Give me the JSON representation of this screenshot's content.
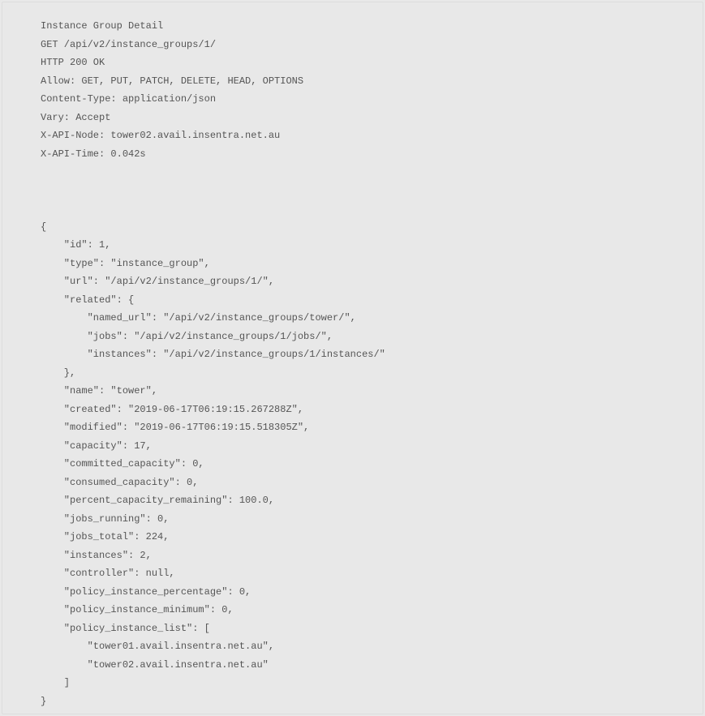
{
  "header": {
    "title": "Instance Group Detail",
    "request_line": "GET /api/v2/instance_groups/1/",
    "status_line": "HTTP 200 OK",
    "allow": "Allow: GET, PUT, PATCH, DELETE, HEAD, OPTIONS",
    "content_type": "Content-Type: application/json",
    "vary": "Vary: Accept",
    "api_node": "X-API-Node: tower02.avail.insentra.net.au",
    "api_time": "X-API-Time: 0.042s"
  },
  "body": {
    "open_brace": "{",
    "l01": "    \"id\": 1,",
    "l02": "    \"type\": \"instance_group\",",
    "l03": "    \"url\": \"/api/v2/instance_groups/1/\",",
    "l04": "    \"related\": {",
    "l05": "        \"named_url\": \"/api/v2/instance_groups/tower/\",",
    "l06": "        \"jobs\": \"/api/v2/instance_groups/1/jobs/\",",
    "l07": "        \"instances\": \"/api/v2/instance_groups/1/instances/\"",
    "l08": "    },",
    "l09": "    \"name\": \"tower\",",
    "l10": "    \"created\": \"2019-06-17T06:19:15.267288Z\",",
    "l11": "    \"modified\": \"2019-06-17T06:19:15.518305Z\",",
    "l12": "    \"capacity\": 17,",
    "l13": "    \"committed_capacity\": 0,",
    "l14": "    \"consumed_capacity\": 0,",
    "l15": "    \"percent_capacity_remaining\": 100.0,",
    "l16": "    \"jobs_running\": 0,",
    "l17": "    \"jobs_total\": 224,",
    "l18": "    \"instances\": 2,",
    "l19": "    \"controller\": null,",
    "l20": "    \"policy_instance_percentage\": 0,",
    "l21": "    \"policy_instance_minimum\": 0,",
    "l22": "    \"policy_instance_list\": [",
    "l23": "        \"tower01.avail.insentra.net.au\",",
    "l24": "        \"tower02.avail.insentra.net.au\"",
    "l25": "    ]",
    "close_brace": "}"
  }
}
